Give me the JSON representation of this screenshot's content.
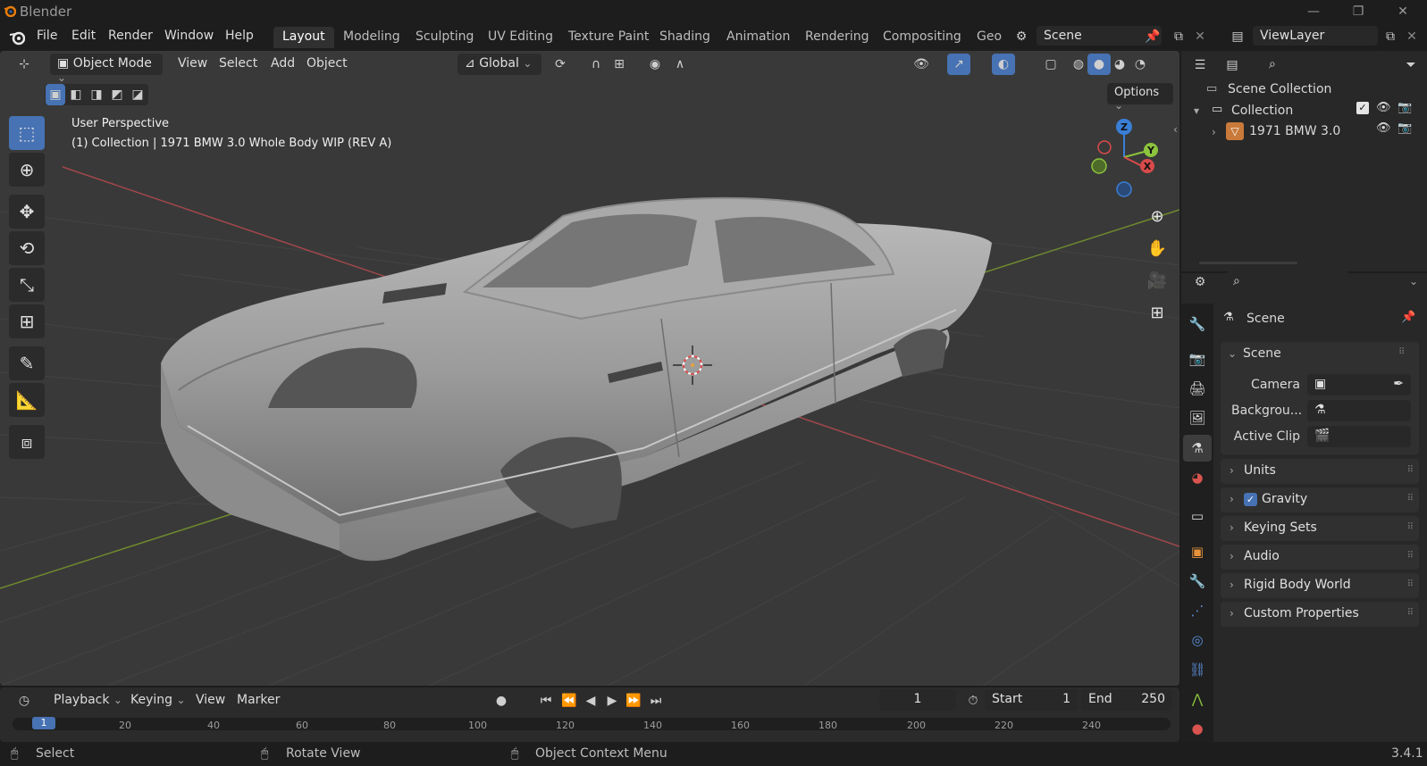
{
  "app": {
    "title": "Blender",
    "version": "3.4.1"
  },
  "menu": [
    "File",
    "Edit",
    "Render",
    "Window",
    "Help"
  ],
  "workspaces": [
    "Layout",
    "Modeling",
    "Sculpting",
    "UV Editing",
    "Texture Paint",
    "Shading",
    "Animation",
    "Rendering",
    "Compositing",
    "Geo"
  ],
  "active_workspace": "Layout",
  "scene_field": "Scene",
  "viewlayer_field": "ViewLayer",
  "viewport_header": {
    "mode": "Object Mode",
    "menus": [
      "View",
      "Select",
      "Add",
      "Object"
    ],
    "transform_orientation": "Global",
    "options_label": "Options"
  },
  "viewport_overlay": {
    "line1": "User Perspective",
    "line2": "(1) Collection | 1971 BMW 3.0 Whole Body WIP (REV A)"
  },
  "gizmo": {
    "z": "Z",
    "y": "Y",
    "x": "X"
  },
  "outliner": {
    "root": "Scene Collection",
    "collection": "Collection",
    "object": "1971 BMW 3.0"
  },
  "properties": {
    "context": "Scene",
    "panel_title": "Scene",
    "fields": [
      {
        "label": "Camera"
      },
      {
        "label": "Backgrou..."
      },
      {
        "label": "Active Clip"
      }
    ],
    "panels": [
      "Units",
      "Gravity",
      "Keying Sets",
      "Audio",
      "Rigid Body World",
      "Custom Properties"
    ],
    "gravity_checked": true
  },
  "timeline": {
    "menus": [
      "Playback",
      "Keying",
      "View",
      "Marker"
    ],
    "current_frame": "1",
    "start_label": "Start",
    "start_value": "1",
    "end_label": "End",
    "end_value": "250",
    "ticks": [
      "1",
      "20",
      "40",
      "60",
      "80",
      "100",
      "120",
      "140",
      "160",
      "180",
      "200",
      "220",
      "240"
    ]
  },
  "statusbar": {
    "select": "Select",
    "rotate": "Rotate View",
    "context_menu": "Object Context Menu"
  },
  "colors": {
    "accent": "#4772b3",
    "x_axis": "#d94a4a",
    "y_axis": "#8cc43d",
    "z_axis": "#3a7fd6"
  }
}
